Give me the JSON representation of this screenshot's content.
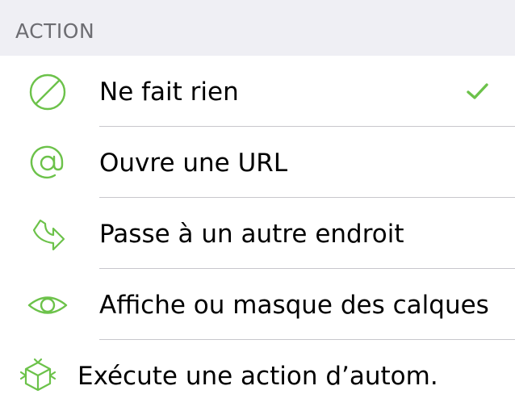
{
  "section": {
    "title": "ACTION"
  },
  "accent_color": "#6cc24a",
  "options": [
    {
      "label": "Ne fait rien",
      "icon": "no-action-icon",
      "selected": true
    },
    {
      "label": "Ouvre une URL",
      "icon": "at-sign-icon",
      "selected": false
    },
    {
      "label": "Passe à un autre endroit",
      "icon": "jump-arrow-icon",
      "selected": false
    },
    {
      "label": "Affiche ou masque des calques",
      "icon": "eye-icon",
      "selected": false
    },
    {
      "label": "Exécute une action d’autom.",
      "icon": "automation-icon",
      "selected": false
    }
  ]
}
